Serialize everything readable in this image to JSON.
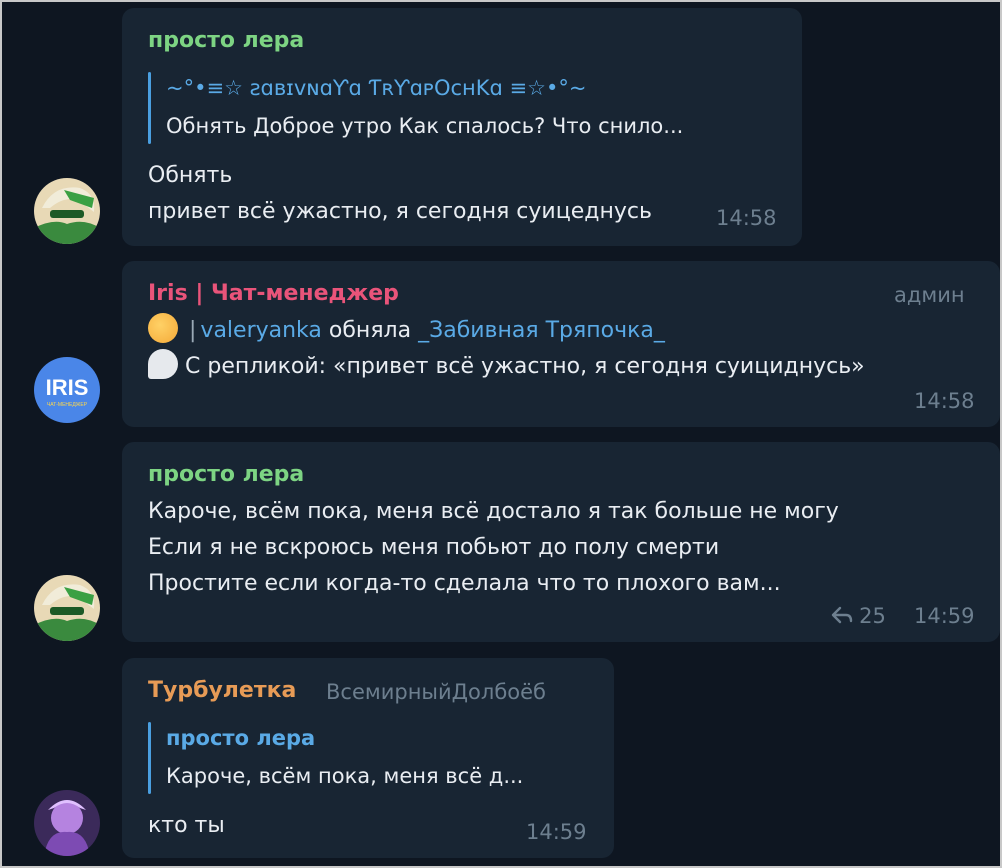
{
  "colors": {
    "background": "#0e1621",
    "bubble": "#182533",
    "name_green": "#7dd483",
    "name_pink": "#e9547a",
    "name_orange": "#e79b56",
    "link_blue": "#5aaae6",
    "meta_gray": "#6d7f8f"
  },
  "messages": [
    {
      "sender": "просто лера",
      "reply_to": {
        "name": "~°•≡☆ ƨɑʙɪvɴɑƳɑ ƬʀƳɑᴘOcнKɑ ≡☆•°~",
        "text": "Обнять Доброе утро  Как спалось?  Что снило..."
      },
      "lines": [
        "Обнять",
        "привет всё ужастно, я сегодня суицеднусь"
      ],
      "time": "14:58"
    },
    {
      "sender": "Iris | Чат-менеджер",
      "role": "админ",
      "avatar_text": "IRIS",
      "avatar_subtext": "ЧАТ-МЕНЕДЖЕР",
      "line1": {
        "emoji": "hugging-face-icon",
        "separator": "|",
        "user1": "valeryanka",
        "action": "обняла",
        "user2": "_Забивная Тряпочка_"
      },
      "line2": {
        "emoji": "speech-bubble-icon",
        "text": "С репликой: «привет всё ужастно, я сегодня суициднусь»"
      },
      "time": "14:58"
    },
    {
      "sender": "просто лера",
      "lines": [
        "Кароче, всём пока, меня всё достало я так больше не могу",
        "Если я не вскроюсь меня побьют до полу смерти",
        "Простите если когда-то сделала что то плохого вам..."
      ],
      "reply_count": "25",
      "time": "14:59"
    },
    {
      "sender": "Турбулетка",
      "title": "ВсемирныйДолбоёб",
      "reply_to": {
        "name": "просто лера",
        "text": "Кароче, всём пока, меня всё д..."
      },
      "lines": [
        "кто ты"
      ],
      "time": "14:59"
    }
  ]
}
